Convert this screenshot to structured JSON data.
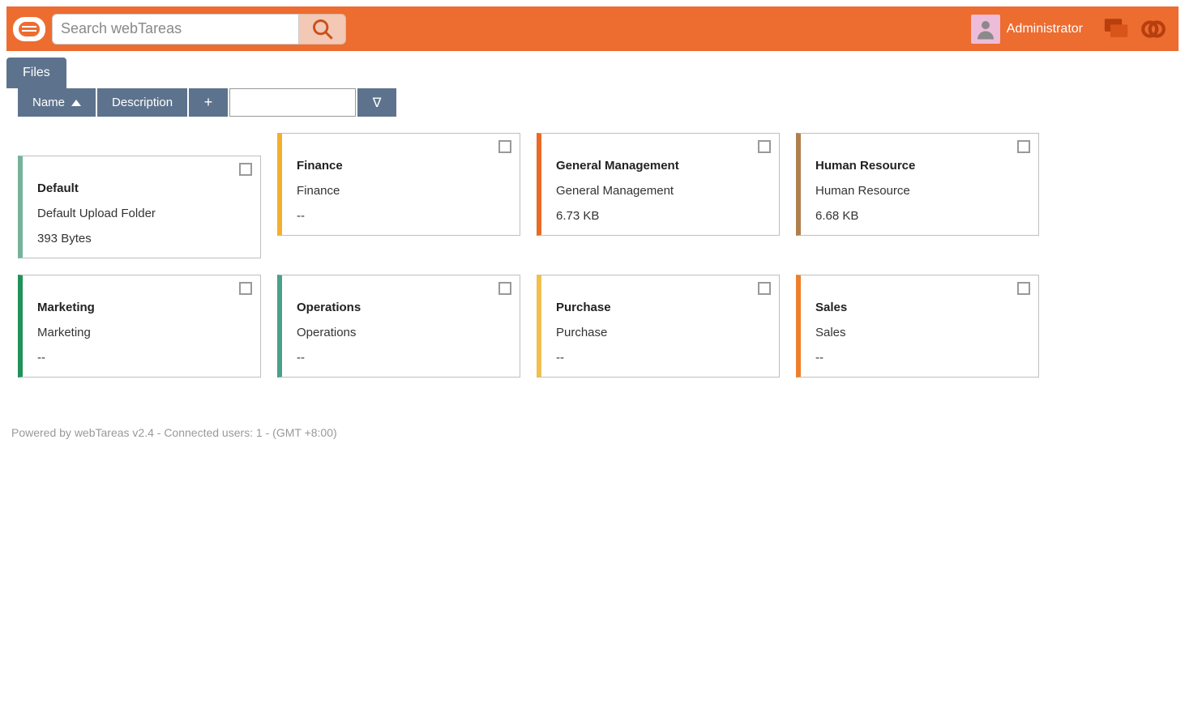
{
  "header": {
    "search_placeholder": "Search webTareas",
    "username": "Administrator"
  },
  "tab": {
    "label": "Files"
  },
  "toolbar": {
    "sort_label": "Name",
    "desc_label": "Description",
    "plus_label": "+",
    "nabla_label": "∇"
  },
  "cards": [
    {
      "title": "Default",
      "desc": "Default Upload Folder",
      "size": "393 Bytes",
      "color": "#76b39a",
      "firstOffset": true
    },
    {
      "title": "Finance",
      "desc": "Finance",
      "size": "--",
      "color": "#f2b02e"
    },
    {
      "title": "General Management",
      "desc": "General Management",
      "size": "6.73 KB",
      "color": "#e86a25"
    },
    {
      "title": "Human Resource",
      "desc": "Human Resource",
      "size": "6.68 KB",
      "color": "#b07f4e"
    },
    {
      "title": "Marketing",
      "desc": "Marketing",
      "size": "--",
      "color": "#229158"
    },
    {
      "title": "Operations",
      "desc": "Operations",
      "size": "--",
      "color": "#4aa088"
    },
    {
      "title": "Purchase",
      "desc": "Purchase",
      "size": "--",
      "color": "#f0bf4f"
    },
    {
      "title": "Sales",
      "desc": "Sales",
      "size": "--",
      "color": "#ee7f2c"
    }
  ],
  "footer": {
    "text": "Powered by webTareas v2.4 - Connected users: 1 - (GMT +8:00)"
  }
}
